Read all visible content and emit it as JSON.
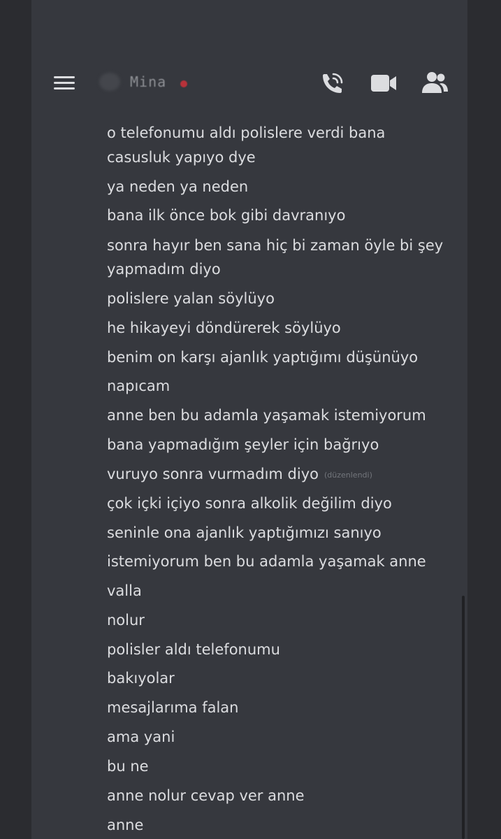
{
  "header": {
    "menu_icon": "hamburger-menu-icon",
    "channel_name": "Mina",
    "status_color": "#b8323a",
    "actions": {
      "call_icon": "phone-call-icon",
      "video_icon": "video-camera-icon",
      "members_icon": "members-icon"
    }
  },
  "messages": [
    "o telefonumu aldı polislere verdi bana",
    "casusluk yapıyo dye",
    "ya neden ya neden",
    "bana ilk önce bok gibi davranıyo",
    "sonra hayır ben sana hiç bi zaman öyle bi şey",
    "yapmadım diyo",
    "polislere yalan söylüyo",
    "he hikayeyi döndürerek söylüyo",
    "benim on karşı ajanlık yaptığımı düşünüyo",
    "napıcam",
    "anne ben bu adamla yaşamak istemiyorum",
    "bana yapmadığım şeyler için bağrıyo",
    "vuruyo sonra vurmadım diyo",
    "çok içki içiyo sonra alkolik değilim diyo",
    "seninle ona ajanlık yaptığımızı sanıyo",
    "istemiyorum ben bu adamla yaşamak anne",
    "valla",
    "nolur",
    "polisler aldı telefonumu",
    "bakıyolar",
    "mesajlarıma falan",
    "ama yani",
    "bu ne",
    "anne nolur cevap ver anne",
    "anne"
  ],
  "edited_label": "(düzenlendi)",
  "colors": {
    "background": "#2f3034",
    "chat_panel": "#36383e",
    "message_text": "#dcdde0",
    "edited_text": "#73767c",
    "icon": "#dcdde0"
  }
}
